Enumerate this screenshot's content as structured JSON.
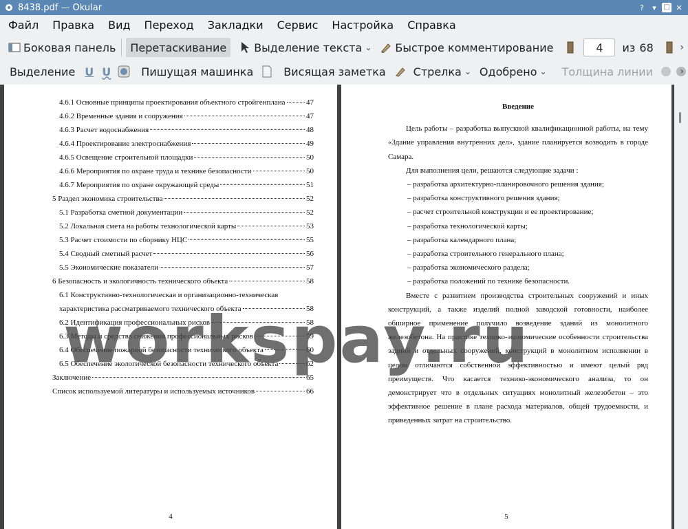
{
  "window": {
    "title": "8438.pdf — Okular"
  },
  "menu": [
    "Файл",
    "Правка",
    "Вид",
    "Переход",
    "Закладки",
    "Сервис",
    "Настройка",
    "Справка"
  ],
  "toolbar1": {
    "sidebar": "Боковая панель",
    "drag": "Перетаскивание",
    "text_select": "Выделение текста",
    "quick_annotate": "Быстрое комментирование",
    "page_current": "4",
    "page_of": "из",
    "page_total": "68"
  },
  "toolbar2": {
    "highlight": "Выделение",
    "typewriter": "Пишущая машинка",
    "note": "Висящая заметка",
    "arrow": "Стрелка",
    "stamp": "Одобрено",
    "line_width": "Толщина линии"
  },
  "left_page": {
    "toc": [
      {
        "level": 3,
        "text": "4.6.1 Основные принципы проектирования объектного стройгенплана",
        "page": "47"
      },
      {
        "level": 3,
        "text": "4.6.2 Временные здания и сооружения",
        "page": "47"
      },
      {
        "level": 3,
        "text": "4.6.3 Расчет водоснабжения",
        "page": "48"
      },
      {
        "level": 3,
        "text": "4.6.4 Проектирование электроснабжения",
        "page": "49"
      },
      {
        "level": 3,
        "text": "4.6.5 Освещение строительной площадки",
        "page": "50"
      },
      {
        "level": 3,
        "text": "4.6.6 Мероприятия по охране труда и технике безопасности",
        "page": "50"
      },
      {
        "level": 3,
        "text": "4.6.7 Мероприятия по охране окружающей среды",
        "page": "51"
      },
      {
        "level": 1,
        "text": "5 Раздел экономика строительства",
        "page": "52"
      },
      {
        "level": 2,
        "text": "5.1 Разработка сметной документации",
        "page": "52"
      },
      {
        "level": 2,
        "text": "5.2 Локальная смета на работы технологической карты",
        "page": "53"
      },
      {
        "level": 2,
        "text": "5.3 Расчет стоимости по сборнику НЦС",
        "page": "55"
      },
      {
        "level": 2,
        "text": "5.4 Сводный сметный расчет",
        "page": "56"
      },
      {
        "level": 2,
        "text": "5.5 Экономические показатели",
        "page": "57"
      },
      {
        "level": 1,
        "text": "6 Безопасность и экологичность технического объекта",
        "page": "58"
      },
      {
        "level": 2,
        "text": "6.1 Конструктивно-технологическая и организационно-техническая",
        "page": ""
      },
      {
        "level": 2,
        "text": "характеристика рассматриваемого технического объекта",
        "page": "58"
      },
      {
        "level": 2,
        "text": "6.2 Идентификация профессиональных рисков",
        "page": "58"
      },
      {
        "level": 2,
        "text": "6.3 Методы и средства снижения профессиональных рисков",
        "page": "59"
      },
      {
        "level": 2,
        "text": "6.4 Обеспечение пожарной безопасности технического объекта",
        "page": "60"
      },
      {
        "level": 2,
        "text": "6.5 Обеспечение экологической безопасности технического объекта",
        "page": "62"
      },
      {
        "level": 1,
        "text": "Заключение",
        "page": "65"
      },
      {
        "level": 1,
        "text": "Список используемой литературы и используемых источников",
        "page": "66"
      }
    ],
    "page_number": "4"
  },
  "right_page": {
    "heading": "Введение",
    "p1": "Цель работы – разработка выпускной квалификационной работы, на тему «Здание управления внутренних дел», здание планируется возводить в городе Самара.",
    "p2": "Для выполнения цели, решаются следующие задачи :",
    "items": [
      "–  разработка архитектурно-планировочного решения здания;",
      "–  разработка конструктивного решения здания;",
      "–  расчет строительной конструкции и ее проектирование;",
      "–  разработка технологической карты;",
      "–  разработка календарного плана;",
      "–  разработка строительного генерального плана;",
      "–  разработка экономического раздела;",
      "–  разработка положений по технике безопасности."
    ],
    "p3": "Вместе с развитием производства строительных сооружений и иных конструкций, а также изделий полной заводской готовности, наиболее обширное применение получило возведение зданий из монолитного железобетона. На практике технико-экономические особенности строительства задний и отдельных сооружений, конструкций в монолитном исполнении в целом отличаются собственной эффективностью и имеют целый ряд преимуществ.  Что касается технико-экономического анализа, то он демонстрирует что в отдельных ситуациях монолитный железобетон – это эффективное решение в плане расхода материалов, общей трудоемкости, и приведенных затрат на строительство.",
    "page_number": "5"
  },
  "watermark": "workspay.ru"
}
